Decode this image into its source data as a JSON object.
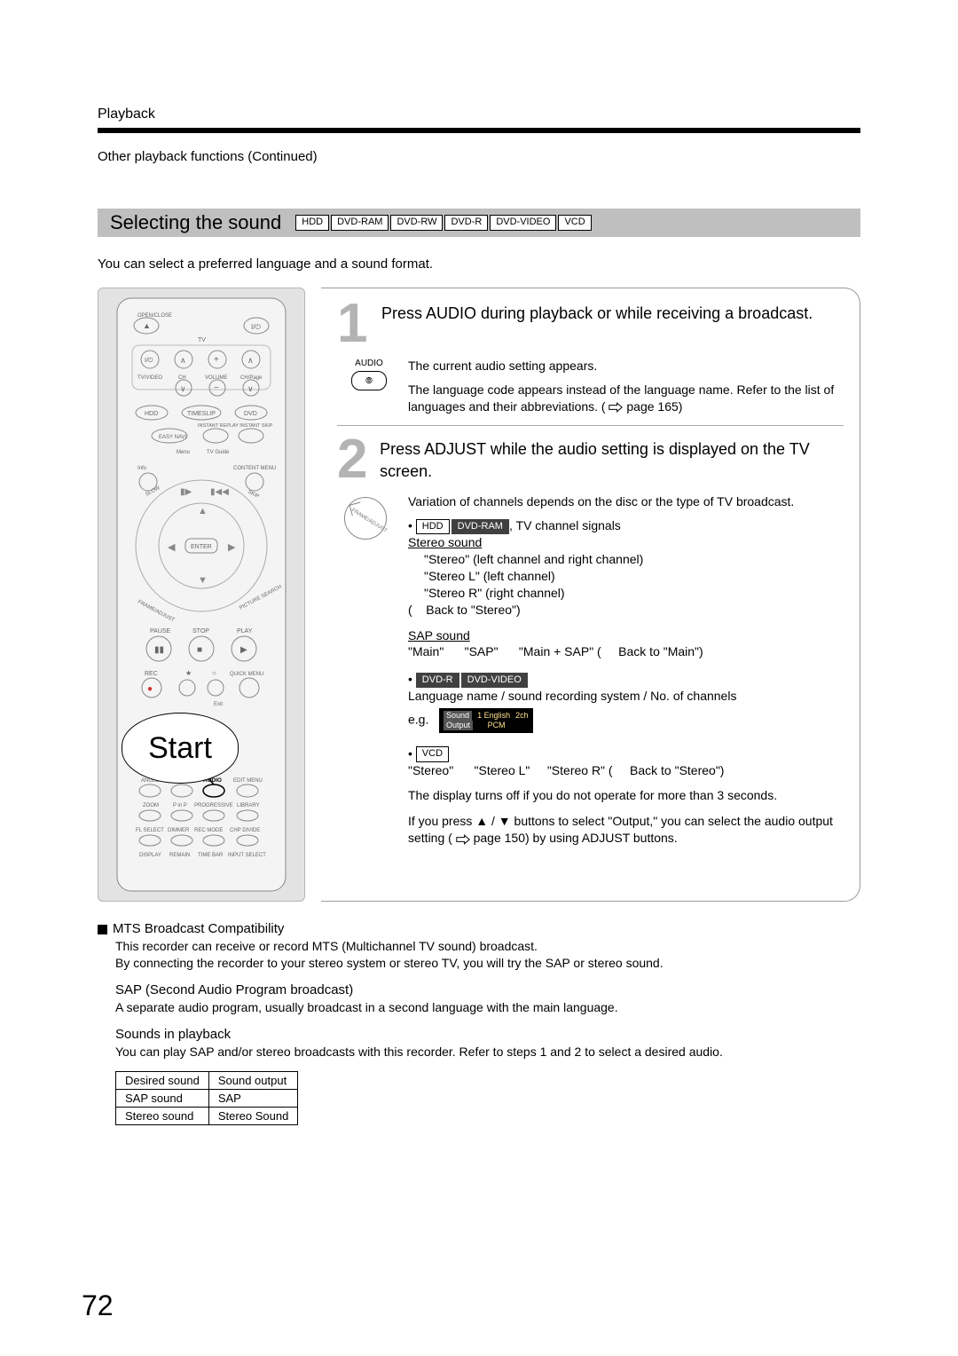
{
  "header": {
    "playback": "Playback",
    "continued": "Other playback functions (Continued)"
  },
  "titlebar": {
    "title": "Selecting the sound",
    "pills": [
      "HDD",
      "DVD-RAM",
      "DVD-RW",
      "DVD-R",
      "DVD-VIDEO",
      "VCD"
    ]
  },
  "intro": "You can select a preferred language and a sound format.",
  "remote": {
    "start": "Start",
    "audio_label": "AUDIO"
  },
  "step1": {
    "num": "1",
    "title": "Press AUDIO during playback or while receiving a broadcast.",
    "icon_label": "AUDIO",
    "line1": "The current audio setting appears.",
    "line2a": "The language code appears instead of the language name. Refer to the list of languages and their abbreviations. (",
    "line2b": " page 165)"
  },
  "step2": {
    "num": "2",
    "title": "Press ADJUST while the audio setting is displayed on the TV screen.",
    "var_line": "Variation of channels depends on the disc or the type of TV broadcast.",
    "tv_pills": [
      "HDD",
      "DVD-RAM"
    ],
    "tv_pills_after": ", TV channel signals",
    "stereo_h": "Stereo sound",
    "stereo_lines": [
      "\"Stereo\" (left channel and right channel)",
      "\"Stereo L\" (left channel)",
      "\"Stereo R\" (right channel)",
      "Back to \"Stereo\")"
    ],
    "stereo_open_paren": "(",
    "sap_h": "SAP sound",
    "sap_line": "\"Main\"      \"SAP\"      \"Main + SAP\" (     Back to \"Main\")",
    "dvdr_pills": [
      "DVD-R",
      "DVD-VIDEO"
    ],
    "lang_line": "Language name / sound recording system / No. of channels",
    "eg_label": "e.g.",
    "eg_box": {
      "sound": "Sound",
      "track": "1  English",
      "ch": "2ch",
      "output": "Output",
      "fmt": "PCM"
    },
    "vcd_pill": "VCD",
    "vcd_line": "\"Stereo\"      \"Stereo L\"     \"Stereo R\" (     Back to \"Stereo\")",
    "off_line": "The display turns off if you do not operate for more than 3 seconds.",
    "output_line_a": "If you press ▲ / ▼ buttons to select \"Output,\" you can select the audio output setting (",
    "output_line_b": " page 150) by using ADJUST buttons."
  },
  "mts": {
    "heading": "MTS Broadcast Compatibility",
    "p1": "This recorder can receive or record MTS (Multichannel TV sound) broadcast.\nBy connecting the recorder to your stereo system or stereo TV, you will try the SAP or stereo sound.",
    "sap_h": "SAP (Second Audio Program broadcast)",
    "sap_p": "A separate audio program, usually broadcast in a second language with the main language.",
    "sip_h": "Sounds in playback",
    "sip_p": "You can play SAP and/or stereo broadcasts with this recorder. Refer to steps 1 and 2 to select a desired audio."
  },
  "table": {
    "headers": [
      "Desired sound",
      "Sound output"
    ],
    "rows": [
      [
        "SAP sound",
        "SAP"
      ],
      [
        "Stereo sound",
        "Stereo Sound"
      ]
    ]
  },
  "page_number": "72"
}
